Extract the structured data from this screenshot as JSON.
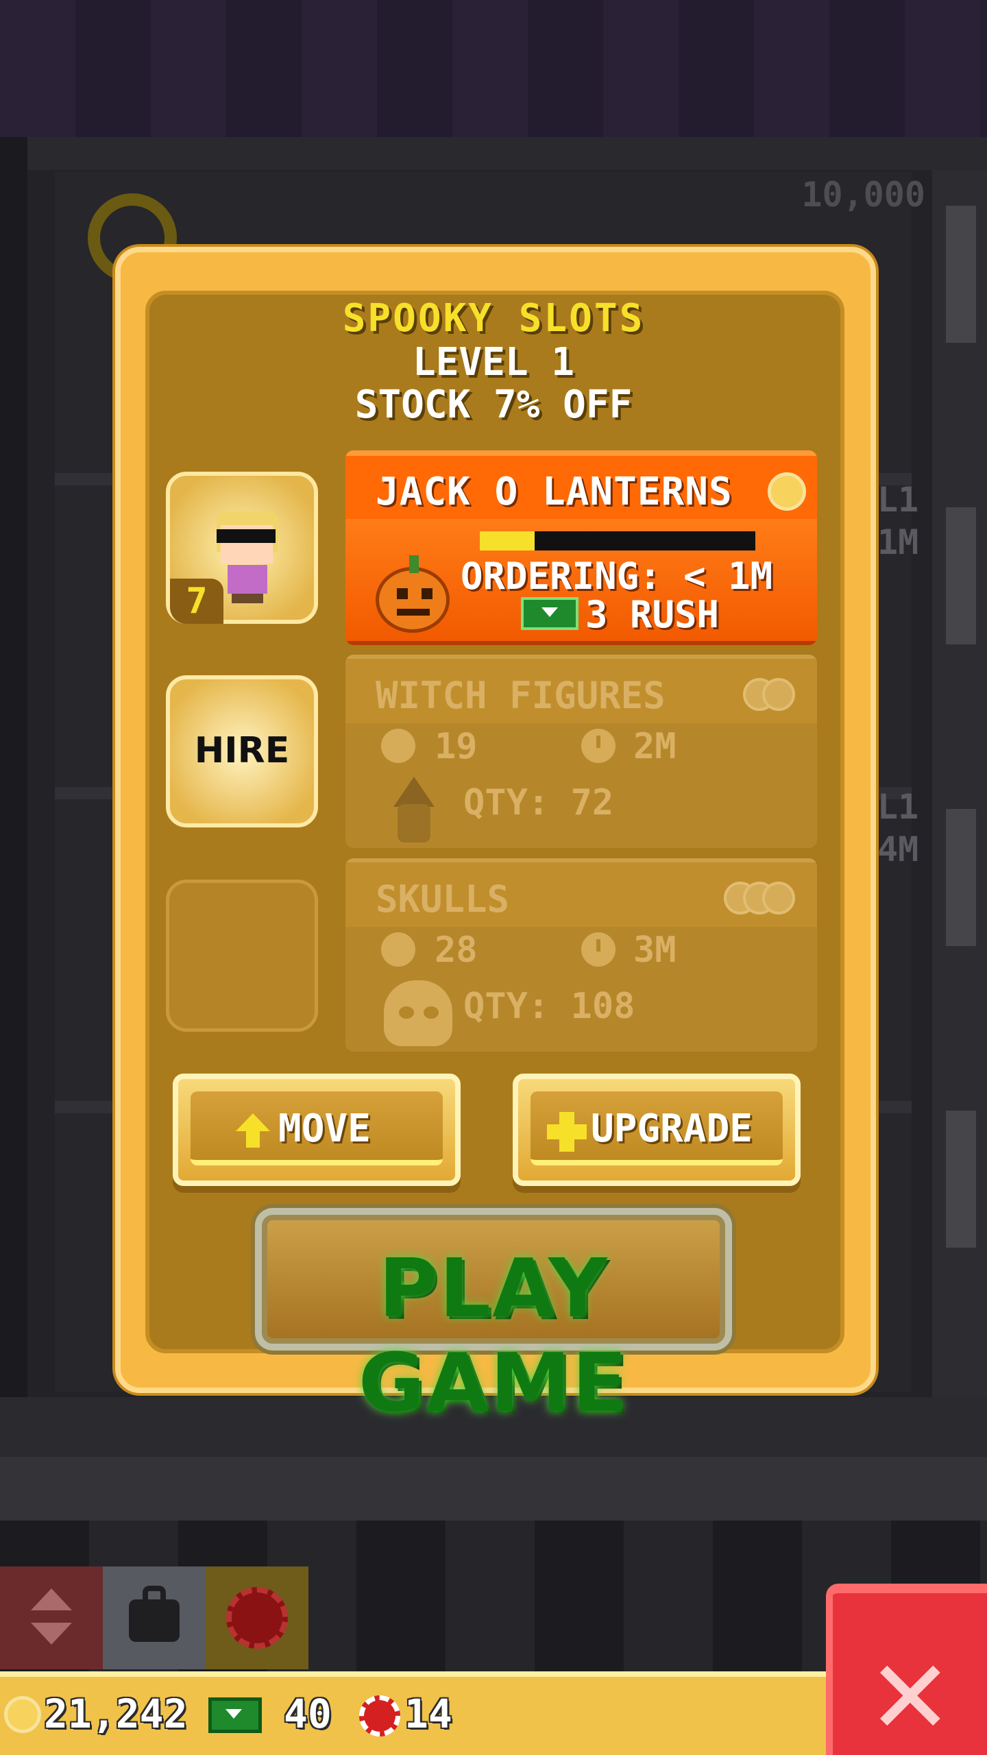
{
  "background": {
    "level_counter_text": "10,000",
    "side_labels": [
      "L1",
      "1M",
      "L1",
      "4M"
    ]
  },
  "shop": {
    "name": "SPOOKY SLOTS",
    "level_text": "LEVEL 1",
    "stock_text": "STOCK 7% OFF"
  },
  "staff": {
    "worker": {
      "dream_job_badge": "7"
    },
    "hire_label": "HIRE"
  },
  "products": [
    {
      "name": "JACK O LANTERNS",
      "status": "ORDERING: < 1M",
      "rush_text": "3 RUSH",
      "progress": 0.2,
      "icon": "pumpkin-icon"
    },
    {
      "name": "WITCH FIGURES",
      "cost": "19",
      "time": "2M",
      "qty_text": "QTY: 72",
      "icon": "witch-icon"
    },
    {
      "name": "SKULLS",
      "cost": "28",
      "time": "3M",
      "qty_text": "QTY: 108",
      "icon": "skull-icon"
    }
  ],
  "buttons": {
    "move_label": "MOVE",
    "upgrade_label": "UPGRADE",
    "play_label": "PLAY GAME"
  },
  "status_bar": {
    "coins": "21,242",
    "bux": "40",
    "tokens": "14"
  },
  "colors": {
    "panel": "#f7b944",
    "panel_inner": "#aa7b1c",
    "active_product": "#ff6a06",
    "title_yellow": "#f7e02a",
    "play_green": "#0f7a12",
    "close_red": "#e8323c"
  }
}
